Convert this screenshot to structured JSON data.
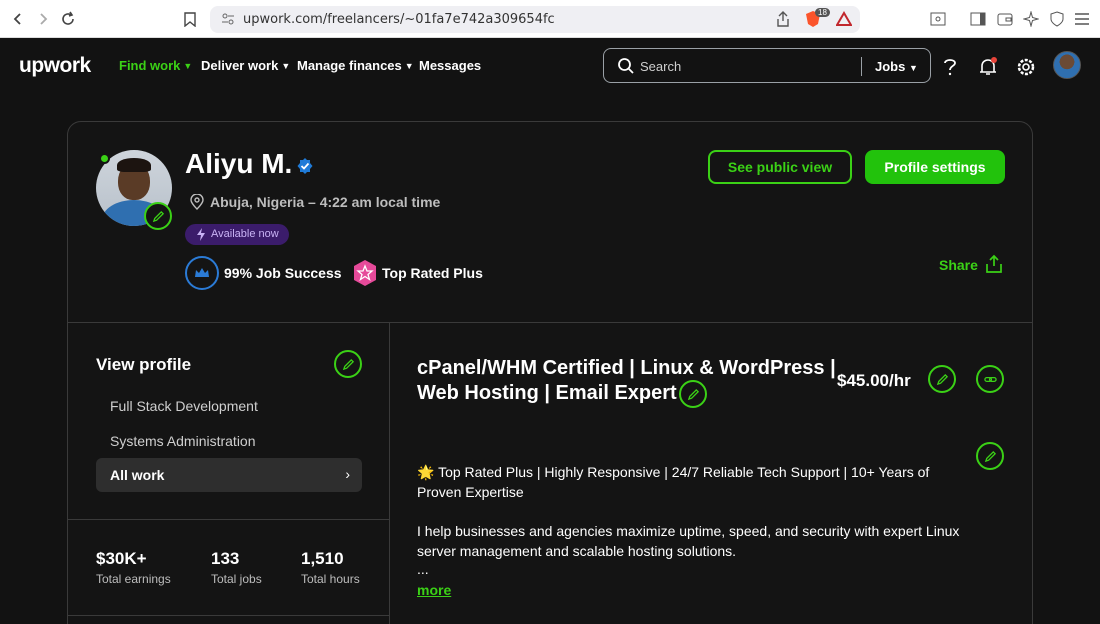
{
  "browser": {
    "url": "upwork.com/freelancers/~01fa7e742a309654fc",
    "shield_count": "18"
  },
  "nav": {
    "logo": "upwork",
    "links": [
      "Find work",
      "Deliver work",
      "Manage finances",
      "Messages"
    ],
    "search_placeholder": "Search",
    "search_scope": "Jobs",
    "accent": "#3bd116"
  },
  "profile": {
    "name": "Aliyu M.",
    "location": "Abuja, Nigeria – 4:22 am local time",
    "availability": "Available now",
    "job_success": "99% Job Success",
    "badge": "Top Rated Plus",
    "see_public_view": "See public view",
    "profile_settings": "Profile settings",
    "share": "Share"
  },
  "sidebar": {
    "title": "View profile",
    "items": [
      "Full Stack Development",
      "Systems Administration"
    ],
    "active_item": "All work"
  },
  "stats": [
    {
      "value": "$30K+",
      "label": "Total earnings"
    },
    {
      "value": "133",
      "label": "Total jobs"
    },
    {
      "value": "1,510",
      "label": "Total hours"
    }
  ],
  "main": {
    "headline": "cPanel/WHM Certified | Linux & WordPress | Web Hosting | Email Expert",
    "rate": "$45.00/hr",
    "desc_line1": "🌟 Top Rated Plus | Highly Responsive | 24/7 Reliable Tech Support | 10+ Years of Proven Expertise",
    "desc_line2": "I help businesses and agencies maximize uptime, speed, and security with expert Linux server management and scalable hosting solutions.",
    "ellipsis": "...",
    "more": "more"
  }
}
